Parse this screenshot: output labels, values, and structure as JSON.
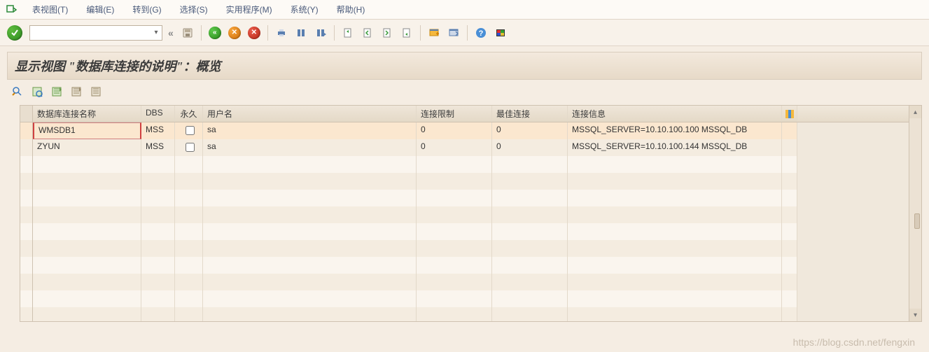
{
  "menu": {
    "items": [
      {
        "label": "表视图(T)",
        "u": "T"
      },
      {
        "label": "编辑(E)",
        "u": "E"
      },
      {
        "label": "转到(G)",
        "u": "G"
      },
      {
        "label": "选择(S)",
        "u": "S"
      },
      {
        "label": "实用程序(M)",
        "u": "M"
      },
      {
        "label": "系统(Y)",
        "u": "Y"
      },
      {
        "label": "帮助(H)",
        "u": "H"
      }
    ]
  },
  "toolbar": {
    "command_value": "",
    "command_placeholder": ""
  },
  "title": "显示视图 \"数据库连接的说明\"：概览",
  "table": {
    "headers": {
      "name": "数据库连接名称",
      "dbs": "DBS",
      "perm": "永久",
      "user": "用户名",
      "limit": "连接限制",
      "best": "最佳连接",
      "info": "连接信息"
    },
    "rows": [
      {
        "selected": true,
        "name": "WMSDB1",
        "dbs": "MSS",
        "perm": false,
        "user": "sa",
        "limit": "0",
        "best": "0",
        "info": "MSSQL_SERVER=10.10.100.100 MSSQL_DB"
      },
      {
        "selected": false,
        "name": "ZYUN",
        "dbs": "MSS",
        "perm": false,
        "user": "sa",
        "limit": "0",
        "best": "0",
        "info": "MSSQL_SERVER=10.10.100.144 MSSQL_DB"
      }
    ],
    "empty_rows": 10
  },
  "watermark": "https://blog.csdn.net/fengxin"
}
